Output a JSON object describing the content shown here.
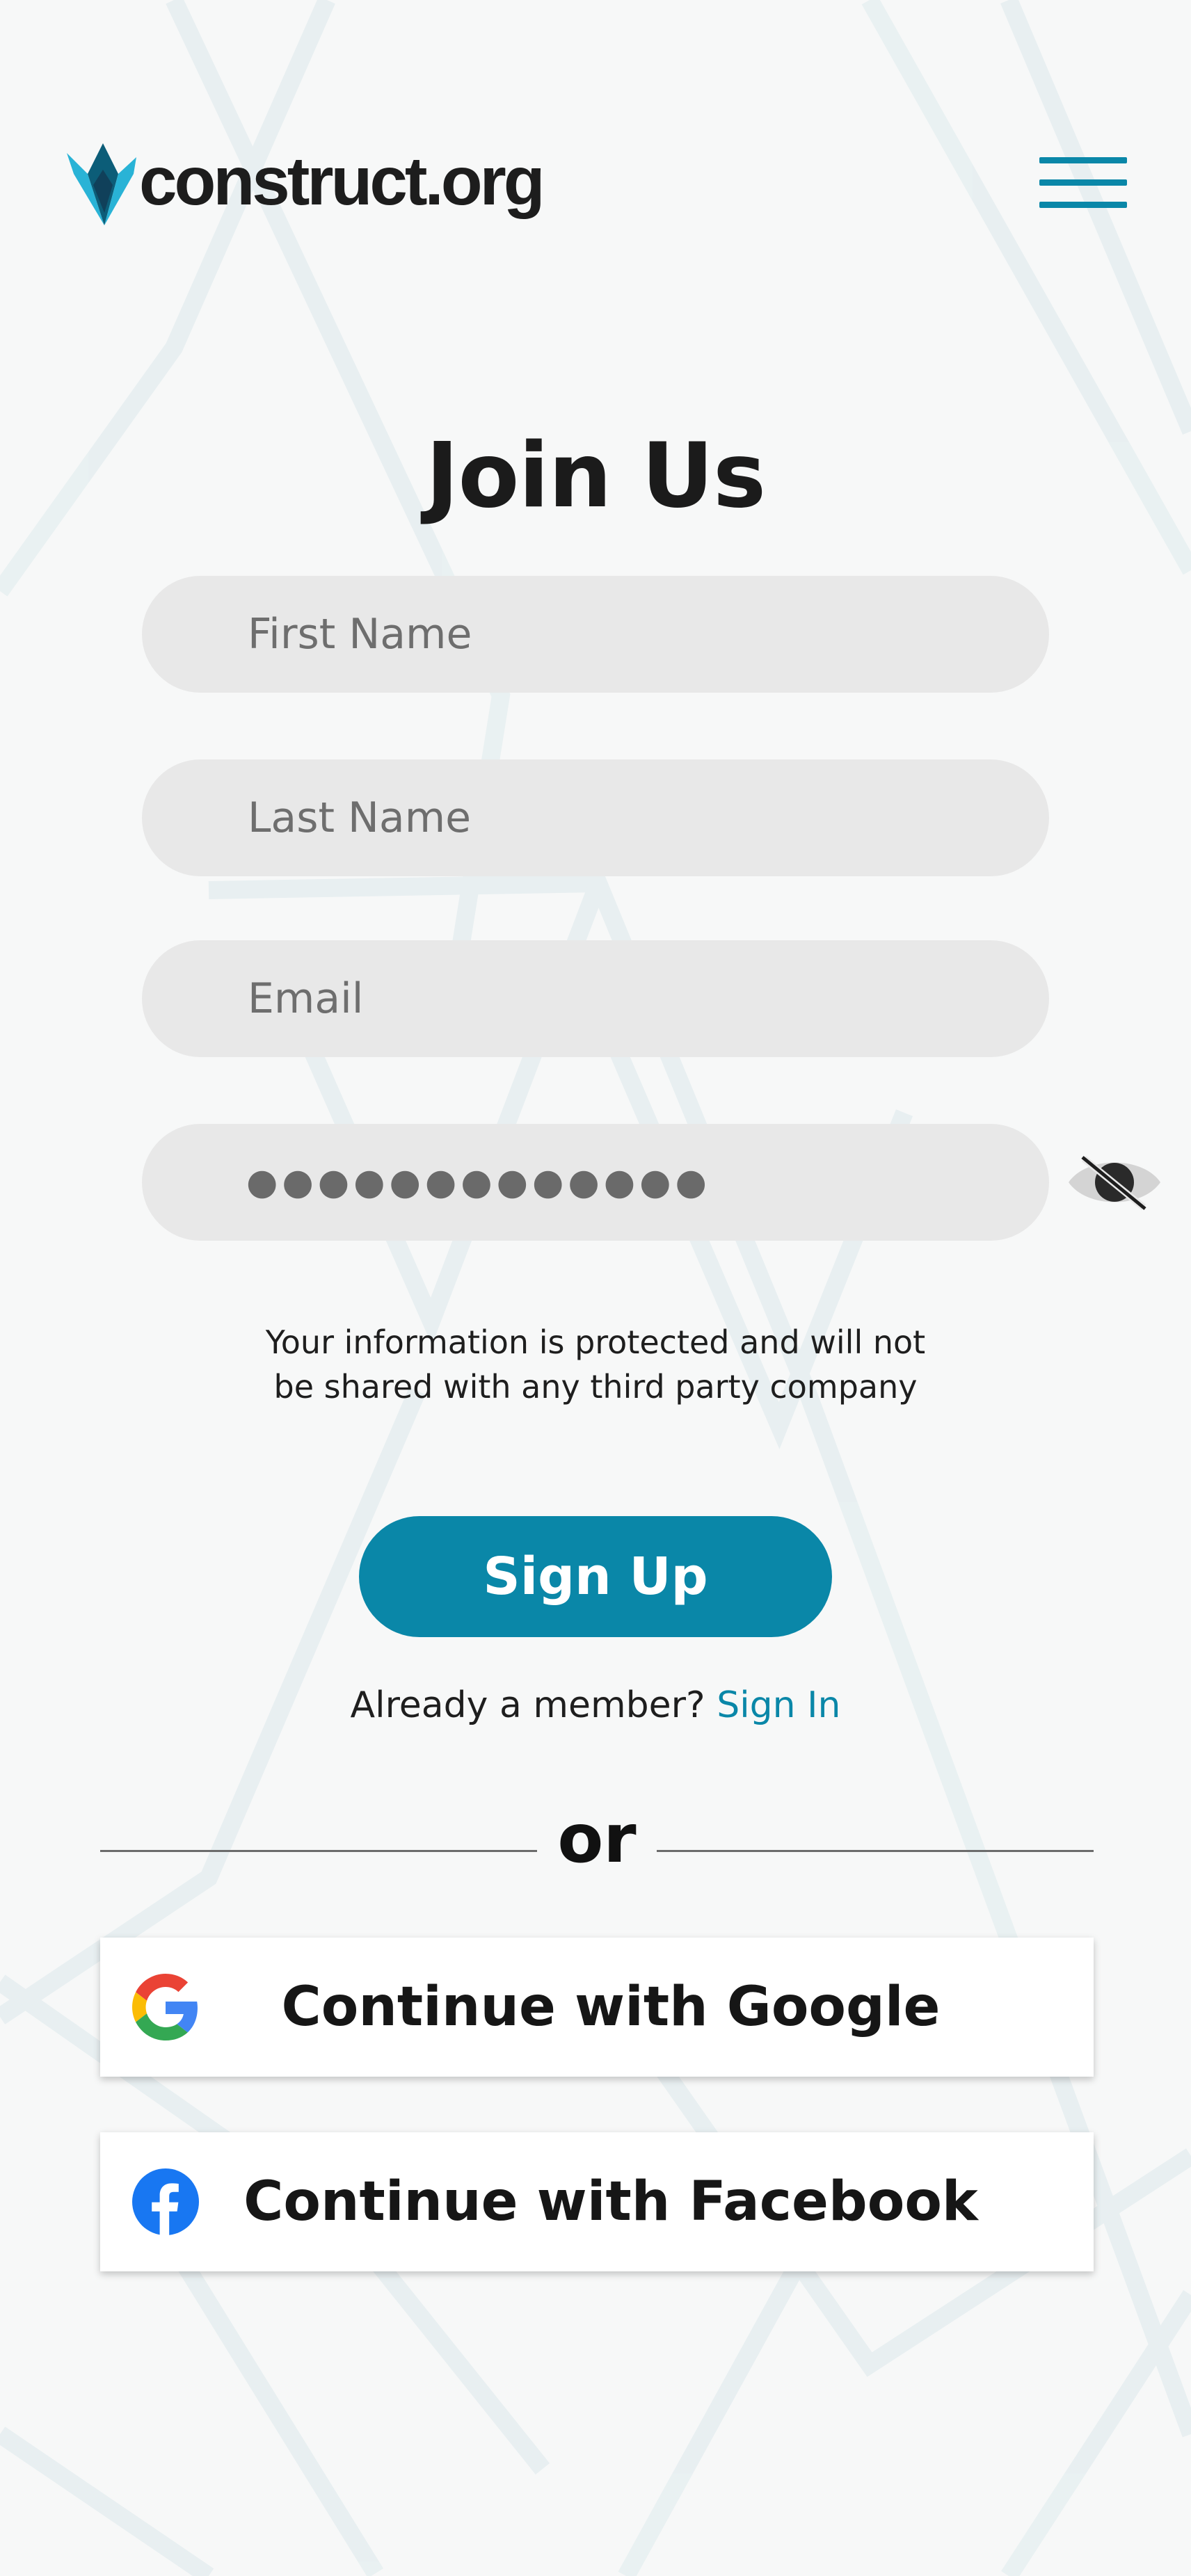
{
  "header": {
    "logo_text": "construct.org",
    "menu_icon": "hamburger-menu-icon"
  },
  "form": {
    "title": "Join Us",
    "first_name_placeholder": "First Name",
    "last_name_placeholder": "Last Name",
    "email_placeholder": "Email",
    "password_masked": "●●●●●●●●●●●●●",
    "password_toggle_icon": "eye-off-icon",
    "privacy_line1": "Your information is protected and will not",
    "privacy_line2": "be shared with any third party company",
    "signup_label": "Sign Up",
    "member_prompt": "Already a member?",
    "signin_link": "Sign In"
  },
  "divider": {
    "label": "or"
  },
  "social": {
    "google_label": "Continue with Google",
    "google_icon": "google-icon",
    "facebook_label": "Continue with Facebook",
    "facebook_icon": "facebook-icon"
  },
  "colors": {
    "accent": "#0a87a8",
    "background": "#f7f8f8",
    "input_bg": "#e8e8e8",
    "text": "#1b1b1b"
  }
}
